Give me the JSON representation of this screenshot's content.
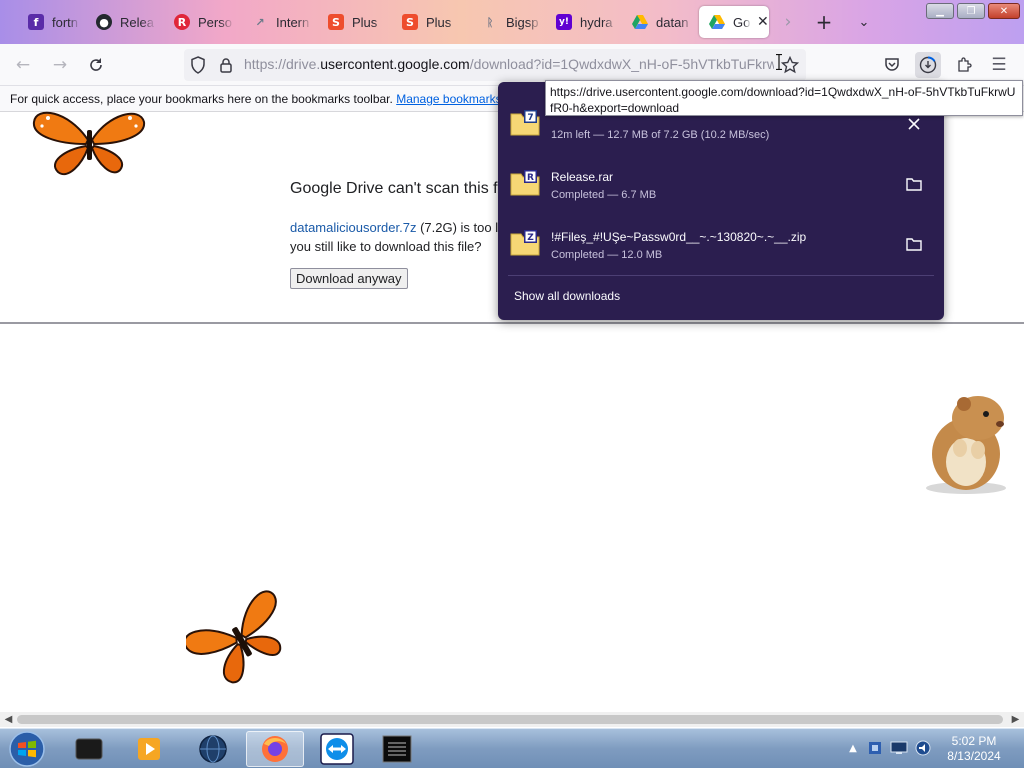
{
  "tabs": [
    {
      "label": "fortn",
      "icon": "fortnite-icon",
      "color": "#5a2ca8",
      "glyph": "f"
    },
    {
      "label": "Relea",
      "icon": "github-icon",
      "color": "#24292f",
      "glyph": "●"
    },
    {
      "label": "Perso",
      "icon": "red-r-icon",
      "color": "#e0263a",
      "glyph": "R"
    },
    {
      "label": "Intern",
      "icon": "trend-icon",
      "color": "#6a7a8a",
      "glyph": "↗"
    },
    {
      "label": "Plus",
      "icon": "shop-bag-icon",
      "color": "#ee4d2d",
      "glyph": "S"
    },
    {
      "label": "Plus",
      "icon": "shop-bag-icon",
      "color": "#ee4d2d",
      "glyph": "S"
    },
    {
      "label": "Bigsp",
      "icon": "bigsp-icon",
      "color": "#7d7d8a",
      "glyph": "ᚱ"
    },
    {
      "label": "hydra",
      "icon": "yahoo-icon",
      "color": "#6001d2",
      "glyph": "y!"
    },
    {
      "label": "datan",
      "icon": "google-drive-icon",
      "color": "#1fa463",
      "glyph": "▲"
    },
    {
      "label": "Go",
      "icon": "google-drive-icon",
      "color": "#1fa463",
      "glyph": "▲",
      "active": true
    }
  ],
  "address_bar": {
    "url_prefix": "https://drive.",
    "url_host": "usercontent.google.com",
    "url_suffix": "/download?id=1QwdxdwX_nH-oF-5hVTkbTuFkrw"
  },
  "bookmarks_toolbar": {
    "message": "For quick access, place your bookmarks here on the bookmarks toolbar.",
    "link": "Manage bookmarks..."
  },
  "page": {
    "warning_title": "Google Drive can't scan this f",
    "file_name": "datamaliciousorder.7z",
    "body_rest": " (7.2G) is too l",
    "body_line2": "you still like to download this file?",
    "download_button": "Download anyway"
  },
  "tooltip": {
    "text": "https://drive.usercontent.google.com/download?id=1QwdxdwX_nH-oF-5hVTkbTuFkrwUfR0-h&export=download"
  },
  "downloads_panel": {
    "items": [
      {
        "name": "",
        "status": "12m left — 12.7 MB of 7.2 GB (10.2 MB/sec)",
        "badge": "7",
        "badge_color": "#1f3c88",
        "action_icon": "cancel-icon"
      },
      {
        "name": "Release.rar",
        "status": "Completed — 6.7 MB",
        "badge": "R",
        "badge_color": "#2a2a8a",
        "action_icon": "folder-icon"
      },
      {
        "name": "!#Fileş_#!UŞe~Passw0rd__~.~130820~.~__.zip",
        "status": "Completed — 12.0 MB",
        "badge": "Z",
        "badge_color": "#2a2a8a",
        "action_icon": "folder-icon"
      }
    ],
    "show_all": "Show all downloads"
  },
  "taskbar": {
    "apps": [
      "media-center-icon",
      "vlc-icon",
      "globe-icon",
      "firefox-icon",
      "teamviewer-icon",
      "terminal-icon"
    ],
    "clock_time": "5:02 PM",
    "clock_date": "8/13/2024"
  },
  "colors": {
    "panel_bg": "#2b1e4f",
    "link": "#0061e0",
    "file_link": "#1a5aa8"
  }
}
